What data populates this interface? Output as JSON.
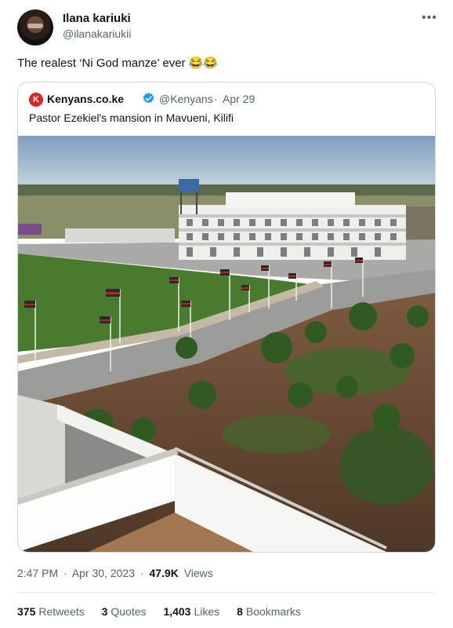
{
  "author": {
    "display_name": "Ilana kariuki",
    "handle": "@ilanakariukii"
  },
  "tweet": {
    "text": "The realest ‘Ni God manze’ ever 😂😂"
  },
  "more_icon": "more-horizontal-icon",
  "quoted": {
    "logo_letter": "K",
    "name": "Kenyans.co.ke",
    "verified": true,
    "handle": "@Kenyans",
    "separator": "·",
    "date": "Apr 29",
    "text": "Pastor Ezekiel's mansion in Mavueni, Kilifi",
    "image": {
      "subject": "mansion-aerial-photo",
      "brand_color": "#d6262b",
      "verified_color": "#1d9bf0"
    }
  },
  "meta": {
    "time": "2:47 PM",
    "sep1": "·",
    "date": "Apr 30, 2023",
    "sep2": "·",
    "views_count": "47.9K",
    "views_label": "Views"
  },
  "stats": {
    "retweets": {
      "count": "375",
      "label": "Retweets"
    },
    "quotes": {
      "count": "3",
      "label": "Quotes"
    },
    "likes": {
      "count": "1,403",
      "label": "Likes"
    },
    "bookmarks": {
      "count": "8",
      "label": "Bookmarks"
    }
  }
}
